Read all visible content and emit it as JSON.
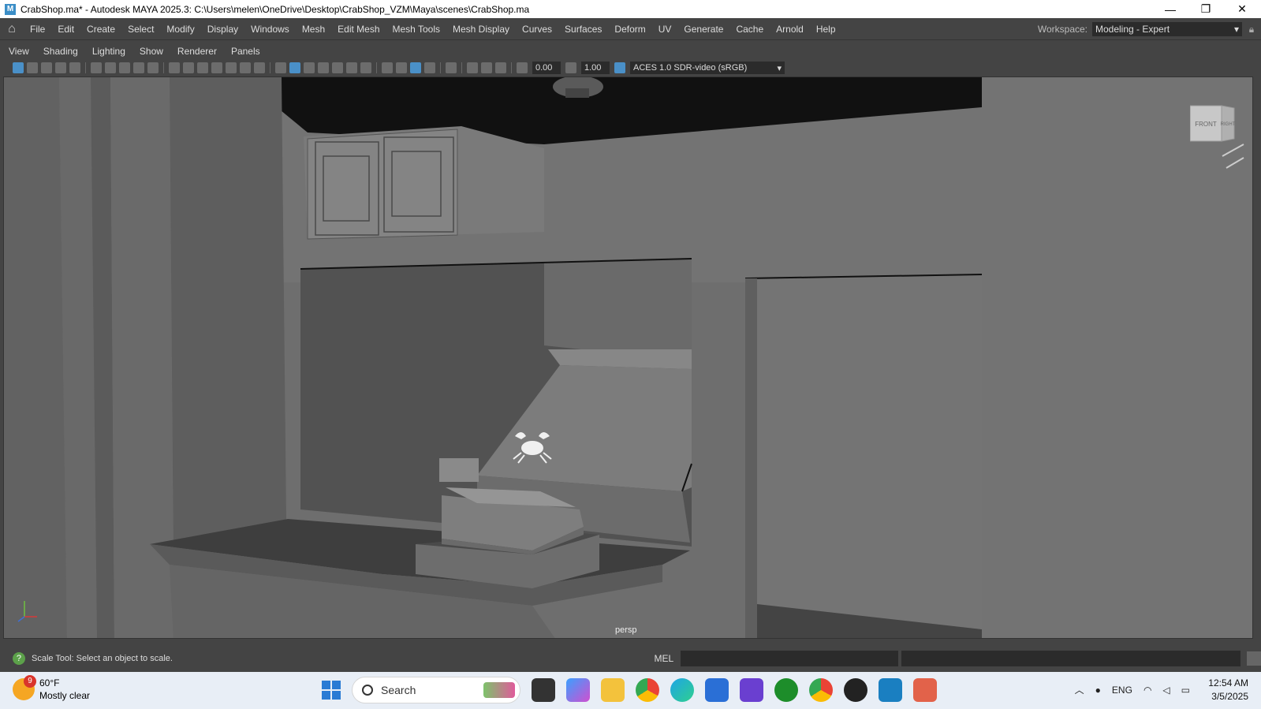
{
  "window": {
    "title": "CrabShop.ma* - Autodesk MAYA 2025.3: C:\\Users\\melen\\OneDrive\\Desktop\\CrabShop_VZM\\Maya\\scenes\\CrabShop.ma",
    "app_icon_letter": "M",
    "minimize": "—",
    "maximize": "❐",
    "close": "✕"
  },
  "menubar": {
    "items": [
      "File",
      "Edit",
      "Create",
      "Select",
      "Modify",
      "Display",
      "Windows",
      "Mesh",
      "Edit Mesh",
      "Mesh Tools",
      "Mesh Display",
      "Curves",
      "Surfaces",
      "Deform",
      "UV",
      "Generate",
      "Cache",
      "Arnold",
      "Help"
    ],
    "workspace_label": "Workspace:",
    "workspace_value": "Modeling - Expert"
  },
  "panel_menu": {
    "items": [
      "View",
      "Shading",
      "Lighting",
      "Show",
      "Renderer",
      "Panels"
    ]
  },
  "panel_toolbar": {
    "exposure": "0.00",
    "gamma": "1.00",
    "color_space": "ACES 1.0 SDR-video (sRGB)"
  },
  "viewport": {
    "camera_label": "persp",
    "viewcube_front": "FRONT",
    "viewcube_right": "RIGHT"
  },
  "helpline": {
    "message": "Scale Tool: Select an object to scale.",
    "mel_label": "MEL",
    "icon": "?"
  },
  "taskbar": {
    "weather_temp": "60°F",
    "weather_desc": "Mostly clear",
    "weather_badge": "9",
    "search_placeholder": "Search",
    "language": "ENG",
    "time": "12:54 AM",
    "date": "3/5/2025"
  }
}
